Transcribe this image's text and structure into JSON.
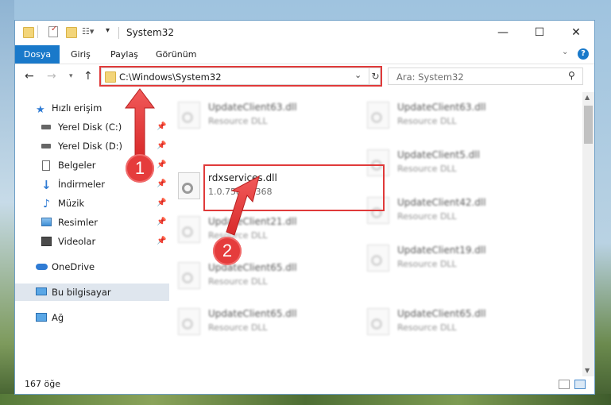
{
  "window": {
    "title": "System32"
  },
  "ribbon": {
    "tabs": [
      "Dosya",
      "Giriş",
      "Paylaş",
      "Görünüm"
    ]
  },
  "address": {
    "path": "C:\\Windows\\System32"
  },
  "search": {
    "placeholder": "Ara: System32"
  },
  "sidebar": {
    "quick_access": "Hızlı erişim",
    "items": [
      {
        "label": "Yerel Disk (C:)",
        "icon": "drive-icon",
        "pinned": true
      },
      {
        "label": "Yerel Disk (D:)",
        "icon": "drive-icon",
        "pinned": true
      },
      {
        "label": "Belgeler",
        "icon": "documents-icon",
        "pinned": true
      },
      {
        "label": "İndirmeler",
        "icon": "download-icon",
        "pinned": true
      },
      {
        "label": "Müzik",
        "icon": "music-icon",
        "pinned": true
      },
      {
        "label": "Resimler",
        "icon": "pictures-icon",
        "pinned": true
      },
      {
        "label": "Videolar",
        "icon": "videos-icon",
        "pinned": true
      }
    ],
    "onedrive": "OneDrive",
    "this_pc": "Bu bilgisayar",
    "network": "Ağ"
  },
  "files": {
    "left_column": [
      {
        "name": "UpdateClient63.dll",
        "type": "Resource DLL"
      },
      {
        "name": "rdxservices.dll",
        "type": "1.0.758.19368"
      },
      {
        "name": "UpdateClient21.dll",
        "type": "Resource DLL"
      },
      {
        "name": "UpdateClient65.dll",
        "type": "Resource DLL"
      },
      {
        "name": "UpdateClient65.dll",
        "type": "Resource DLL"
      }
    ],
    "right_column": [
      {
        "name": "UpdateClient63.dll",
        "type": "Resource DLL"
      },
      {
        "name": "UpdateClient5.dll",
        "type": "Resource DLL"
      },
      {
        "name": "UpdateClient42.dll",
        "type": "Resource DLL"
      },
      {
        "name": "UpdateClient19.dll",
        "type": "Resource DLL"
      },
      {
        "name": "UpdateClient65.dll",
        "type": "Resource DLL"
      }
    ]
  },
  "status": {
    "count": "167 öğe"
  },
  "annotations": {
    "step1": "1",
    "step2": "2"
  },
  "colors": {
    "accent": "#1979ca",
    "highlight": "#e03a3a"
  }
}
